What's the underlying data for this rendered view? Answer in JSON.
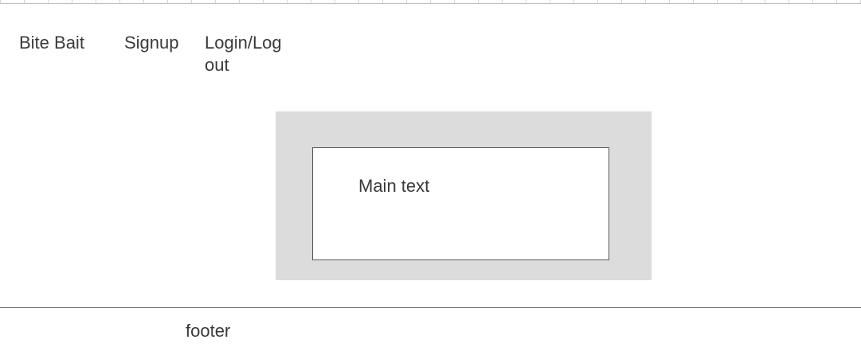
{
  "nav": {
    "brand": "Bite Bait",
    "signup": "Signup",
    "login_logout": "Login/Log out"
  },
  "main": {
    "text": "Main text"
  },
  "footer": {
    "text": "footer"
  },
  "colors": {
    "hero_background": "#dcdcdc",
    "text": "#3a3a3a",
    "divider": "#6a6a6a"
  }
}
